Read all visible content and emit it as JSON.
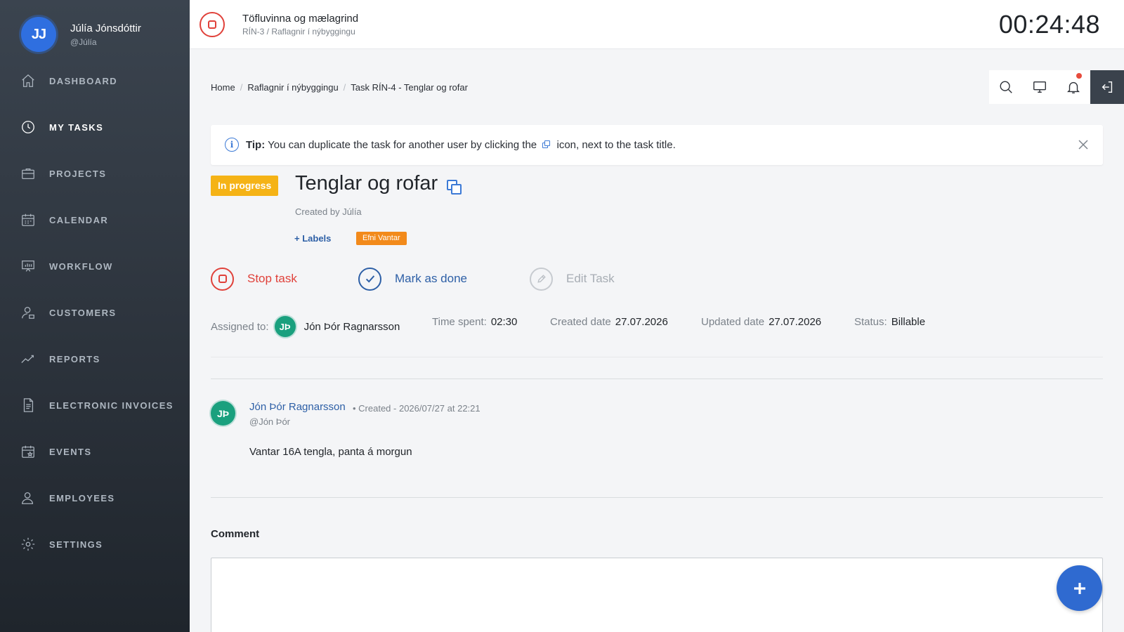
{
  "user": {
    "initials": "JJ",
    "name": "Júlía Jónsdóttir",
    "handle": "@Júlía"
  },
  "sidebar": {
    "items": [
      {
        "label": "DASHBOARD",
        "icon": "home-icon",
        "active": false
      },
      {
        "label": "MY TASKS",
        "icon": "clock-icon",
        "active": true
      },
      {
        "label": "PROJECTS",
        "icon": "briefcase-icon",
        "active": false
      },
      {
        "label": "CALENDAR",
        "icon": "calendar-icon",
        "active": false
      },
      {
        "label": "WORKFLOW",
        "icon": "presentation-board-icon",
        "active": false
      },
      {
        "label": "CUSTOMERS",
        "icon": "user-icon",
        "active": false
      },
      {
        "label": "REPORTS",
        "icon": "trend-line-icon",
        "active": false
      },
      {
        "label": "ELECTRONIC INVOICES",
        "icon": "document-icon",
        "active": false
      },
      {
        "label": "EVENTS",
        "icon": "calendar-star-icon",
        "active": false
      },
      {
        "label": "EMPLOYEES",
        "icon": "users-icon",
        "active": false
      },
      {
        "label": "SETTINGS",
        "icon": "gear-icon",
        "active": false
      }
    ]
  },
  "topbar": {
    "title": "Töfluvinna og mælagrind",
    "subtitle": "RÍN-3 / Raflagnir í nýbyggingu",
    "timer": "00:24:48"
  },
  "breadcrumb": [
    "Home",
    "Raflagnir í nýbyggingu",
    "Task RÍN-4 - Tenglar og rofar"
  ],
  "tip": {
    "prefix": "Tip:",
    "text_before": "You can duplicate the task for another user by clicking the",
    "text_after": "icon, next to the task title."
  },
  "task": {
    "status": "In progress",
    "title": "Tenglar og rofar",
    "created_by": "Created by Júlía",
    "labels_link": "+ Labels",
    "label_chip": "Efni Vantar",
    "actions": {
      "stop": "Stop task",
      "done": "Mark as done",
      "edit": "Edit Task"
    },
    "meta": {
      "assigned_label": "Assigned to:",
      "assignee_initials": "JÞ",
      "assignee": "Jón Þór Ragnarsson",
      "time_label": "Time spent:",
      "time_value": "02:30",
      "created_label": "Created date",
      "created_value": "27.07.2026",
      "updated_label": "Updated date",
      "updated_value": "27.07.2026",
      "status_label": "Status:",
      "status_value": "Billable"
    }
  },
  "comment": {
    "initials": "JÞ",
    "author": "Jón Þór Ragnarsson",
    "created": "• Created - 2026/07/27 at 22:21",
    "handle": "@Jón Þór",
    "body": "Vantar 16A tengla, panta á morgun"
  },
  "comment_form": {
    "label": "Comment",
    "value": ""
  },
  "colors": {
    "accent": "#2f6ad0",
    "danger": "#e0413a",
    "status": "#f5b316",
    "label": "#f28a1b",
    "sidebar": "#2c333c"
  }
}
